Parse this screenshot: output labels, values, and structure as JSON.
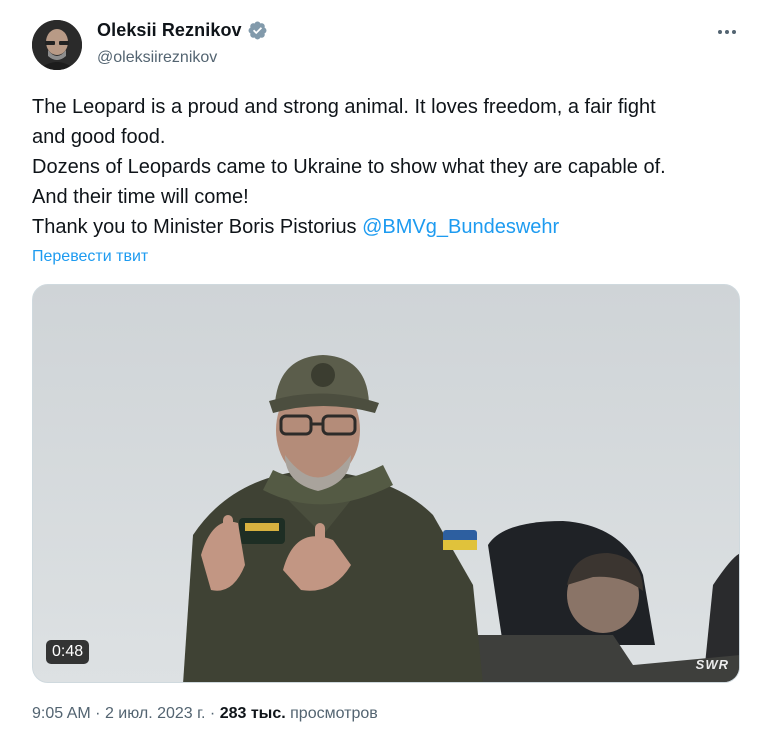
{
  "author": {
    "name": "Oleksii Reznikov",
    "handle": "@oleksiireznikov",
    "verified": true
  },
  "tweet": {
    "text_lines": [
      "The Leopard is a proud and strong animal. It loves freedom, a fair fight",
      "and good food.",
      "Dozens of Leopards came to Ukraine to show what they are capable of.",
      "And their time will come!",
      "Thank you to Minister Boris Pistorius "
    ],
    "mention": "@BMVg_Bundeswehr",
    "translate_label": "Перевести твит"
  },
  "media": {
    "duration": "0:48",
    "watermark": "SWR"
  },
  "meta": {
    "time": "9:05 AM",
    "separator": "·",
    "date": "2 июл. 2023 г.",
    "views_count": "283 тыс.",
    "views_label": "просмотров"
  },
  "icons": {
    "verified": "verified-badge-icon",
    "more": "more-dots-icon"
  },
  "colors": {
    "accent": "#1d9bf0",
    "secondary_text": "#536471",
    "primary_text": "#0f1419"
  }
}
